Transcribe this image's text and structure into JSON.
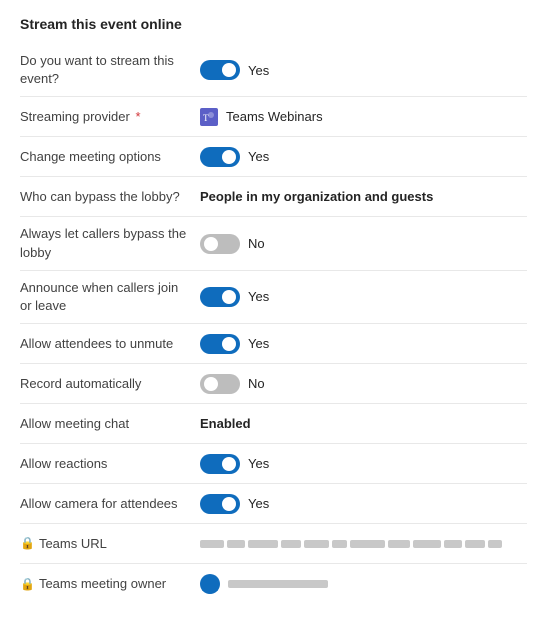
{
  "page": {
    "title": "Stream this event online"
  },
  "rows": [
    {
      "id": "stream-event",
      "label": "Do you want to stream this event?",
      "type": "toggle",
      "toggle_state": "on",
      "toggle_label": "Yes",
      "required": false
    },
    {
      "id": "streaming-provider",
      "label": "Streaming provider",
      "type": "provider",
      "provider_name": "Teams Webinars",
      "required": true
    },
    {
      "id": "change-meeting-options",
      "label": "Change meeting options",
      "type": "toggle",
      "toggle_state": "on",
      "toggle_label": "Yes",
      "required": false
    },
    {
      "id": "bypass-lobby",
      "label": "Who can bypass the lobby?",
      "type": "bold-text",
      "value": "People in my organization and guests",
      "required": false
    },
    {
      "id": "callers-bypass-lobby",
      "label": "Always let callers bypass the lobby",
      "type": "toggle",
      "toggle_state": "off",
      "toggle_label": "No",
      "required": false
    },
    {
      "id": "announce-callers",
      "label": "Announce when callers join or leave",
      "type": "toggle",
      "toggle_state": "on",
      "toggle_label": "Yes",
      "required": false
    },
    {
      "id": "allow-unmute",
      "label": "Allow attendees to unmute",
      "type": "toggle",
      "toggle_state": "on",
      "toggle_label": "Yes",
      "required": false
    },
    {
      "id": "record-automatically",
      "label": "Record automatically",
      "type": "toggle",
      "toggle_state": "off",
      "toggle_label": "No",
      "required": false
    },
    {
      "id": "allow-chat",
      "label": "Allow meeting chat",
      "type": "bold-text",
      "value": "Enabled",
      "required": false
    },
    {
      "id": "allow-reactions",
      "label": "Allow reactions",
      "type": "toggle",
      "toggle_state": "on",
      "toggle_label": "Yes",
      "required": false
    },
    {
      "id": "allow-camera",
      "label": "Allow camera for attendees",
      "type": "toggle",
      "toggle_state": "on",
      "toggle_label": "Yes",
      "required": false
    },
    {
      "id": "teams-url",
      "label": "Teams URL",
      "type": "url",
      "has_lock": true
    },
    {
      "id": "teams-meeting-owner",
      "label": "Teams meeting owner",
      "type": "owner",
      "has_lock": true
    }
  ],
  "icons": {
    "lock": "🔒",
    "teams_provider": "⊞"
  }
}
